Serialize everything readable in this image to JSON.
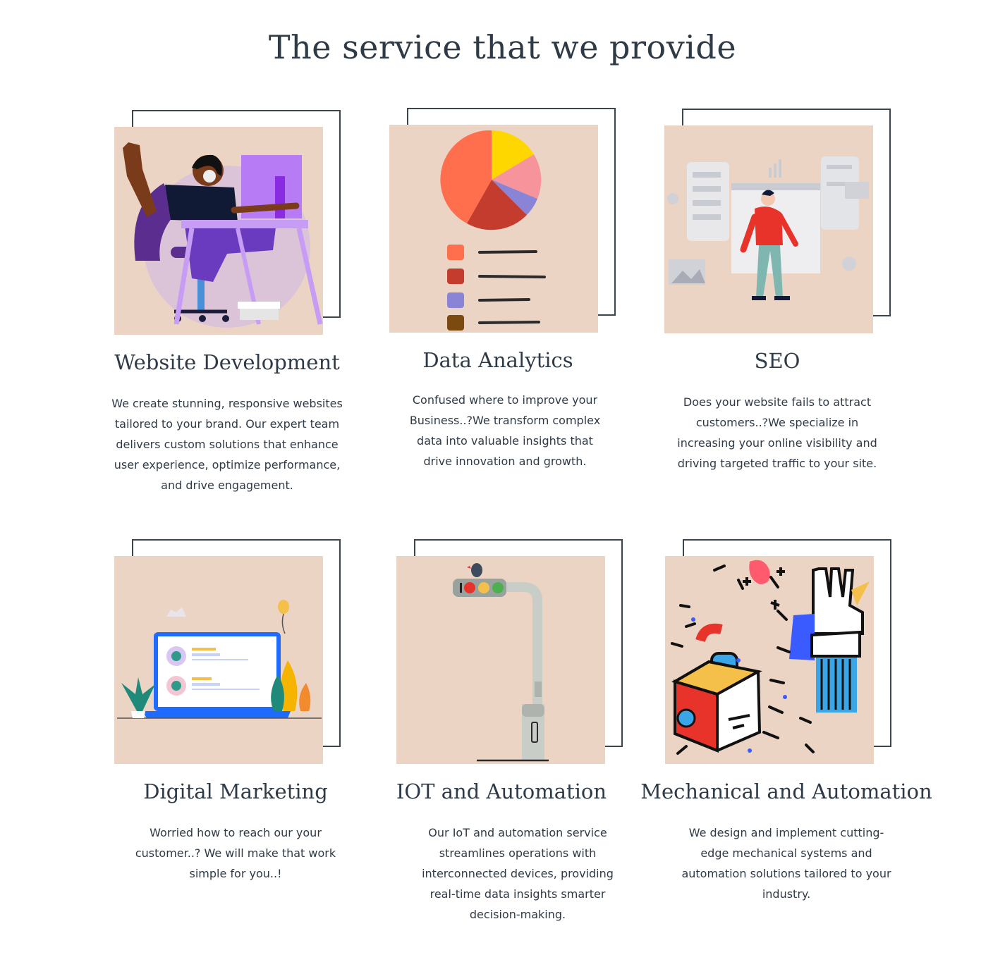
{
  "section": {
    "title": "The service that we provide"
  },
  "services": [
    {
      "title": "Website Development",
      "description": "We create stunning, responsive websites tailored to your brand. Our expert team delivers custom solutions that enhance user experience, optimize performance, and drive engagement.",
      "illustration_icon": "woman-at-computer-illustration"
    },
    {
      "title": "Data Analytics",
      "description": "Confused where to improve your Business..?We transform complex data into valuable insights that drive innovation and growth.",
      "illustration_icon": "pie-chart-illustration"
    },
    {
      "title": "SEO",
      "description": "Does your website fails to attract customers..?We specialize in increasing your online visibility and driving targeted traffic to your site.",
      "illustration_icon": "person-browsing-web-illustration"
    },
    {
      "title": "Digital Marketing",
      "description": "Worried how to reach our your customer..? We will make that work simple for you..!",
      "illustration_icon": "laptop-reviews-illustration"
    },
    {
      "title": "IOT and Automation",
      "description": "Our IoT and automation service streamlines operations with interconnected devices, providing real-time data insights smarter decision-making.",
      "illustration_icon": "traffic-light-illustration"
    },
    {
      "title": "Mechanical and Automation",
      "description": "We design and implement cutting-edge mechanical systems and automation solutions tailored to your industry.",
      "illustration_icon": "abstract-robot-glove-illustration"
    }
  ],
  "colors": {
    "illustration_bg": "#ecd4c4",
    "frame": "#3a4550",
    "text": "#2f3a47"
  }
}
